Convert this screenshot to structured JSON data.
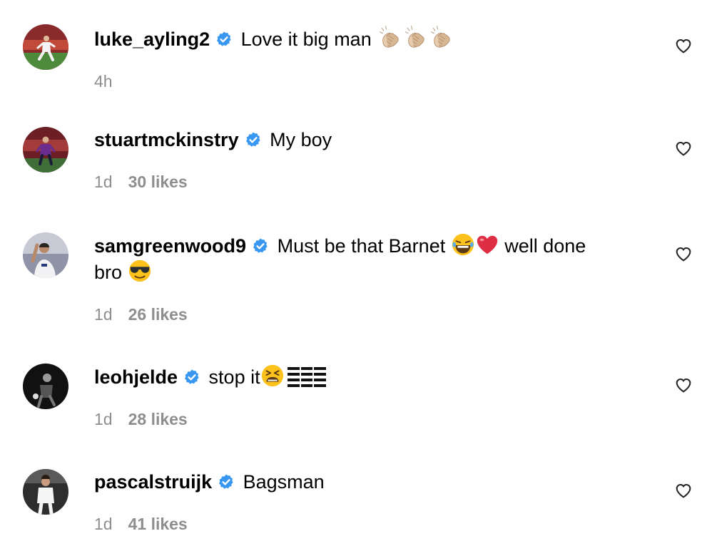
{
  "comments": [
    {
      "username": "luke_ayling2",
      "text": "Love it big man",
      "emoji": [
        "clapping-hands-icon",
        "clapping-hands-icon",
        "clapping-hands-icon"
      ],
      "time": "4h",
      "likes": ""
    },
    {
      "username": "stuartmckinstry",
      "text": "My boy",
      "time": "1d",
      "likes": "30 likes"
    },
    {
      "username": "samgreenwood9",
      "text_a": "Must be that Barnet",
      "text_b": "well done",
      "text_c": "bro",
      "time": "1d",
      "likes": "26 likes"
    },
    {
      "username": "leohjelde",
      "text": "stop it",
      "time": "1d",
      "likes": "28 likes"
    },
    {
      "username": "pascalstruijk",
      "text": "Bagsman",
      "time": "1d",
      "likes": "41 likes"
    }
  ],
  "colors": {
    "verified": "#3897f0",
    "meta": "#8e8e8e"
  }
}
